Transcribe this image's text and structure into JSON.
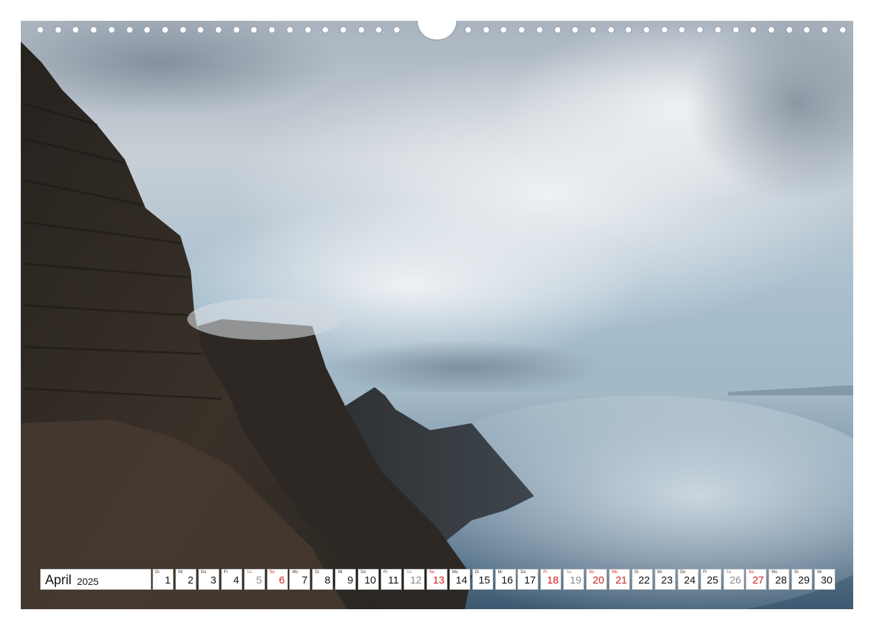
{
  "calendar": {
    "month": "April",
    "year": "2025",
    "days": [
      {
        "wd": "Di",
        "n": "1",
        "t": "w"
      },
      {
        "wd": "Mi",
        "n": "2",
        "t": "w"
      },
      {
        "wd": "Do",
        "n": "3",
        "t": "w"
      },
      {
        "wd": "Fr",
        "n": "4",
        "t": "w"
      },
      {
        "wd": "Sa",
        "n": "5",
        "t": "sat"
      },
      {
        "wd": "So",
        "n": "6",
        "t": "sun"
      },
      {
        "wd": "Mo",
        "n": "7",
        "t": "w"
      },
      {
        "wd": "Di",
        "n": "8",
        "t": "w"
      },
      {
        "wd": "Mi",
        "n": "9",
        "t": "w"
      },
      {
        "wd": "Do",
        "n": "10",
        "t": "w"
      },
      {
        "wd": "Fr",
        "n": "11",
        "t": "w"
      },
      {
        "wd": "Sa",
        "n": "12",
        "t": "sat"
      },
      {
        "wd": "So",
        "n": "13",
        "t": "sun"
      },
      {
        "wd": "Mo",
        "n": "14",
        "t": "w"
      },
      {
        "wd": "Di",
        "n": "15",
        "t": "w"
      },
      {
        "wd": "Mi",
        "n": "16",
        "t": "w"
      },
      {
        "wd": "Do",
        "n": "17",
        "t": "w"
      },
      {
        "wd": "Fr",
        "n": "18",
        "t": "sun"
      },
      {
        "wd": "Sa",
        "n": "19",
        "t": "sat"
      },
      {
        "wd": "So",
        "n": "20",
        "t": "sun"
      },
      {
        "wd": "Mo",
        "n": "21",
        "t": "sun"
      },
      {
        "wd": "Di",
        "n": "22",
        "t": "w"
      },
      {
        "wd": "Mi",
        "n": "23",
        "t": "w"
      },
      {
        "wd": "Do",
        "n": "24",
        "t": "w"
      },
      {
        "wd": "Fr",
        "n": "25",
        "t": "w"
      },
      {
        "wd": "Sa",
        "n": "26",
        "t": "sat"
      },
      {
        "wd": "So",
        "n": "27",
        "t": "sun"
      },
      {
        "wd": "Mo",
        "n": "28",
        "t": "w"
      },
      {
        "wd": "Di",
        "n": "29",
        "t": "w"
      },
      {
        "wd": "Mi",
        "n": "30",
        "t": "w"
      }
    ]
  },
  "colors": {
    "sunday_holiday": "#d02020",
    "saturday": "#8b8b8b",
    "sea": "#5f7f98",
    "rock": "#2f2a25"
  }
}
